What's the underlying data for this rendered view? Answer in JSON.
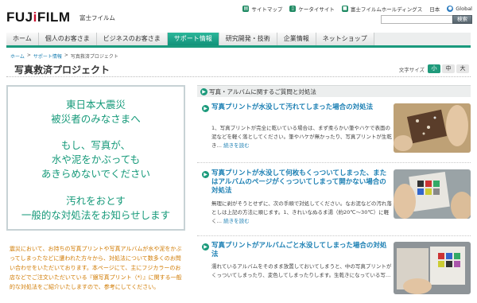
{
  "header": {
    "logo_pre": "FUJ",
    "logo_accent": "i",
    "logo_post": "FILM",
    "logo_jp": "富士フイルム",
    "util_links": [
      {
        "label": "サイトマップ",
        "icon": "sitemap-icon"
      },
      {
        "label": "ケータイサイト",
        "icon": "mobile-icon"
      },
      {
        "label": "富士フイルムホールディングス",
        "icon": "holdings-icon"
      },
      {
        "label": "日本",
        "icon": ""
      },
      {
        "label": "Global",
        "icon": "globe-icon"
      }
    ],
    "search_value": "",
    "search_button": "検索"
  },
  "nav": {
    "items": [
      "ホーム",
      "個人のお客さま",
      "ビジネスのお客さま",
      "サポート情報",
      "研究開発・技術",
      "企業情報",
      "ネットショップ"
    ],
    "active_index": 3
  },
  "breadcrumb": {
    "items": [
      "ホーム",
      "サポート情報",
      "写真救済プロジェクト"
    ],
    "separator": ">"
  },
  "page": {
    "title": "写真救済プロジェクト",
    "font_size_label": "文字サイズ",
    "font_size_options": [
      "小",
      "中",
      "大"
    ],
    "font_size_selected": "小"
  },
  "left": {
    "lines": [
      "東日本大震災",
      "被災者のみなさまへ",
      "もし、写真が、",
      "水や泥をかぶっても",
      "あきらめないでください",
      "汚れをおとす",
      "一般的な対処法をお知らせします"
    ],
    "intro": "震災において、お持ちの写真プリントや写真アルバムが水や泥をかぶってしまったなどに遭われた方々から、対処法について数多くのお問い合わせをいただいております。本ページにて、主にフジカラーのお店などでご注文いただいている『銀写真プリント（*）』に関する一般的な対処法をご紹介いたしますので、参考にしてください。"
  },
  "faq": {
    "header": "写真・アルバムに関するご質問と対処法",
    "more_label": "続きを読む",
    "items": [
      {
        "title": "写真プリントが水没して汚れてしまった場合の対処法",
        "body": "1、写真プリントが完全に乾いている場合は、まず柔らかい筆やハケで表面の泥などを軽く落としてください。筆やハケが無かったり、写真プリントが生乾き…"
      },
      {
        "title": "写真プリントが水没して何枚もくっついてしまった、またはアルバムのページがくっついてしまって開かない場合の対処法",
        "body": "無理に剥がそうとせずに、次の手順で対処してください。なお泥などの汚れ落としは上記の方法に順じます。1、きれいなぬるま湯（約20℃〜30℃）に軽く…"
      },
      {
        "title": "写真プリントがアルバムごと水没してしまった場合の対処法",
        "body": "濡れているアルバムをそのまま放置しておいてしまうと、中の写真プリントがくっついてしまったり、変色してしまったりします。生乾きになっている写…"
      }
    ]
  },
  "colors": {
    "accent": "#1a9a7d",
    "link": "#1b7fb3",
    "intro_text": "#d07a00"
  }
}
